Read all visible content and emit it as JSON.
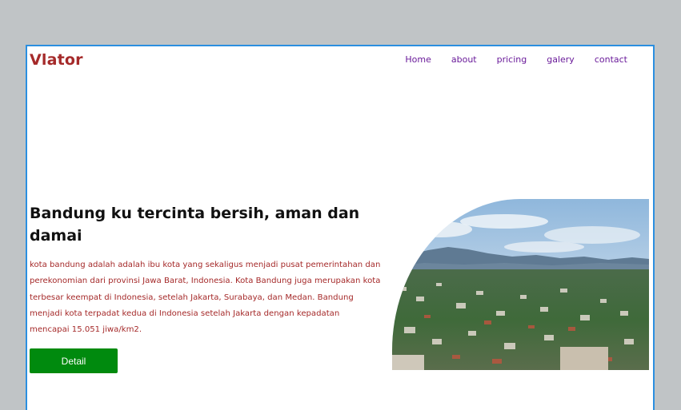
{
  "brand": {
    "logo": "Vlator"
  },
  "nav": {
    "items": [
      {
        "label": "Home"
      },
      {
        "label": "about"
      },
      {
        "label": "pricing"
      },
      {
        "label": "galery"
      },
      {
        "label": "contact"
      }
    ]
  },
  "hero": {
    "title": "Bandung ku tercinta bersih, aman dan damai",
    "text": "kota bandung adalah adalah ibu kota yang sekaligus menjadi pusat pemerintahan dan perekonomian dari provinsi Jawa Barat, Indonesia. Kota Bandung juga merupakan kota terbesar keempat di Indonesia, setelah Jakarta, Surabaya, dan Medan. Bandung menjadi kota terpadat kedua di Indonesia setelah Jakarta dengan kepadatan mencapai 15.051 jiwa/km2.",
    "button_label": "Detail"
  },
  "colors": {
    "frame_border": "#2b8fe0",
    "logo": "#a52a2a",
    "nav_link": "#6a1b9a",
    "body_text": "#a52a2a",
    "button": "#008a0e"
  }
}
